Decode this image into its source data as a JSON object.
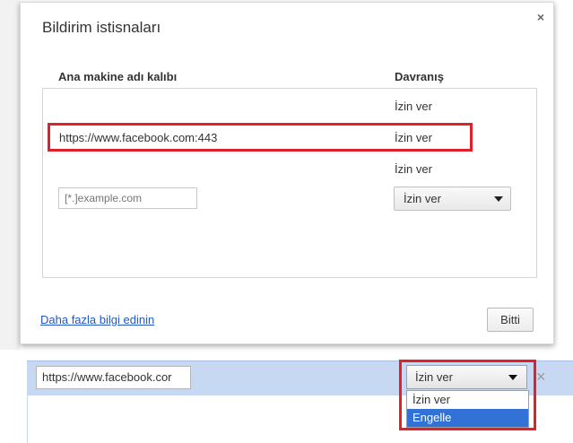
{
  "dialog": {
    "title": "Bildirim istisnaları",
    "close_label": "×",
    "columns": {
      "pattern": "Ana makine adı kalıbı",
      "behavior": "Davranış"
    },
    "rows": [
      {
        "pattern": "",
        "behavior": "İzin ver"
      },
      {
        "pattern": "https://www.facebook.com:443",
        "behavior": "İzin ver"
      },
      {
        "pattern": "",
        "behavior": "İzin ver"
      }
    ],
    "new_entry": {
      "placeholder": "[*.]example.com",
      "behavior_selected": "İzin ver"
    },
    "learn_more_link": "Daha fazla bilgi edinin",
    "done_button": "Bitti"
  },
  "lower": {
    "input_value": "https://www.facebook.cor",
    "select_value": "İzin ver",
    "remove_label": "×",
    "options": [
      "İzin ver",
      "Engelle"
    ],
    "highlighted_option": "Engelle"
  },
  "colors": {
    "highlight": "#e0202a",
    "row_selected_bg": "#c7d8f2",
    "option_selected_bg": "#3271d6",
    "link": "#2358c2"
  }
}
